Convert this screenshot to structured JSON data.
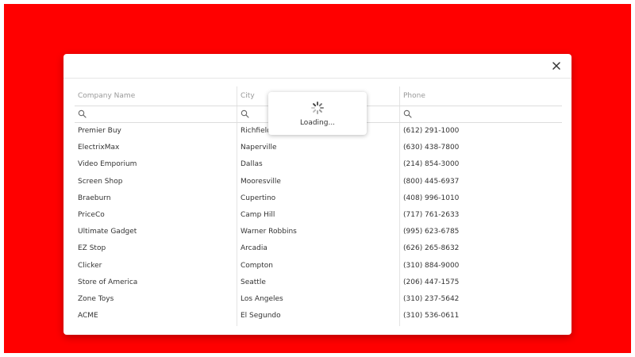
{
  "popup": {
    "close_icon": "close-icon"
  },
  "grid": {
    "columns": [
      "Company Name",
      "City",
      "Phone"
    ],
    "filter_icon": "search-icon",
    "filters": [
      "",
      "",
      ""
    ],
    "rows": [
      [
        "Premier Buy",
        "Richfield",
        "(612) 291-1000"
      ],
      [
        "ElectrixMax",
        "Naperville",
        "(630) 438-7800"
      ],
      [
        "Video Emporium",
        "Dallas",
        "(214) 854-3000"
      ],
      [
        "Screen Shop",
        "Mooresville",
        "(800) 445-6937"
      ],
      [
        "Braeburn",
        "Cupertino",
        "(408) 996-1010"
      ],
      [
        "PriceCo",
        "Camp Hill",
        "(717) 761-2633"
      ],
      [
        "Ultimate Gadget",
        "Warner Robbins",
        "(995) 623-6785"
      ],
      [
        "EZ Stop",
        "Arcadia",
        "(626) 265-8632"
      ],
      [
        "Clicker",
        "Compton",
        "(310) 884-9000"
      ],
      [
        "Store of America",
        "Seattle",
        "(206) 447-1575"
      ],
      [
        "Zone Toys",
        "Los Angeles",
        "(310) 237-5642"
      ],
      [
        "ACME",
        "El Segundo",
        "(310) 536-0611"
      ]
    ]
  },
  "load_panel": {
    "message": "Loading...",
    "icon": "spinner-icon"
  },
  "colors": {
    "background": "#ff0000",
    "popup": "#ffffff",
    "header_text": "#999999",
    "cell_text": "#333333"
  }
}
